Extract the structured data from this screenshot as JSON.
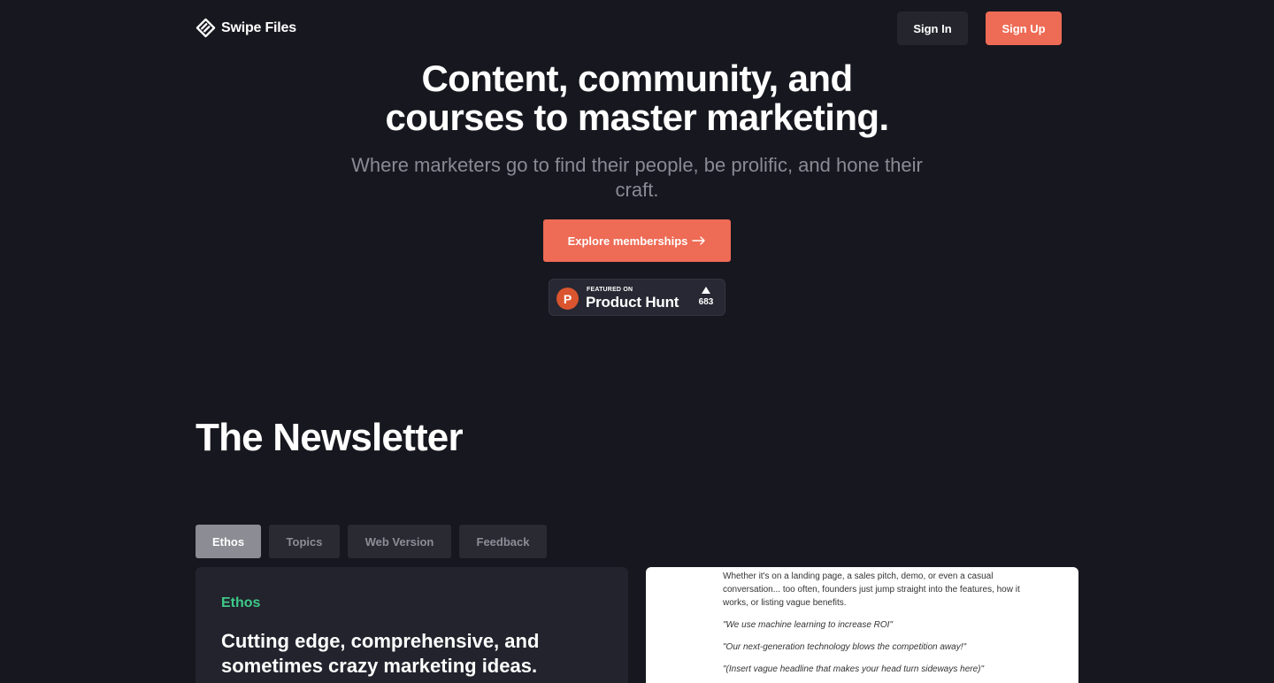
{
  "header": {
    "brand": "Swipe Files",
    "signin_label": "Sign In",
    "signup_label": "Sign Up"
  },
  "hero": {
    "title_line1": "Content, community, and",
    "title_line2": "courses to master marketing.",
    "subtitle": "Where marketers go to find their people, be prolific, and hone their craft.",
    "cta_label": "Explore memberships"
  },
  "product_hunt": {
    "featured": "FEATURED ON",
    "name": "Product Hunt",
    "logo_letter": "P",
    "votes": "683"
  },
  "newsletter": {
    "title": "The Newsletter",
    "tabs": [
      "Ethos",
      "Topics",
      "Web Version",
      "Feedback"
    ],
    "active_tab": "Ethos",
    "card": {
      "eyebrow": "Ethos",
      "heading": "Cutting edge, comprehensive, and sometimes crazy marketing ideas."
    },
    "preview": {
      "paragraph": "Whether it's on a landing page, a sales pitch, demo, or even a casual conversation... too often, founders just jump straight into the features, how it works, or listing vague benefits.",
      "quotes": [
        "\"We use machine learning to increase ROI\"",
        "\"Our next-generation technology blows the competition away!\"",
        "\"(Insert vague headline that makes your head turn sideways here)\""
      ]
    }
  },
  "colors": {
    "background": "#17171f",
    "accent": "#ee6b55",
    "eyebrow_green": "#3ec98a",
    "product_hunt": "#da552f"
  }
}
